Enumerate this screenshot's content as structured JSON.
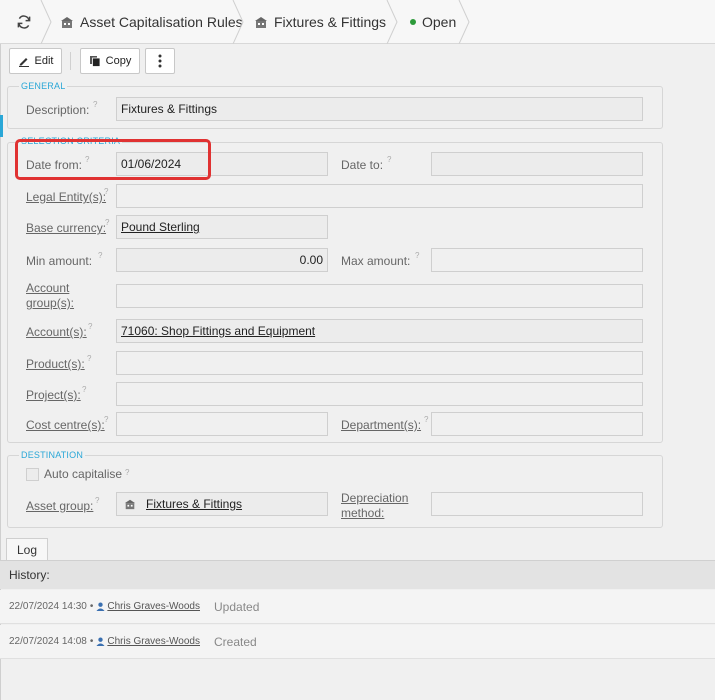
{
  "breadcrumb": {
    "items": [
      "Asset Capitalisation Rules",
      "Fixtures & Fittings"
    ],
    "status": "Open"
  },
  "toolbar": {
    "edit_label": "Edit",
    "copy_label": "Copy"
  },
  "general": {
    "legend": "GENERAL",
    "description_label": "Description:",
    "description_value": "Fixtures & Fittings"
  },
  "criteria": {
    "legend": "SELECTION CRITERIA",
    "date_from_label": "Date from:",
    "date_from_value": "01/06/2024",
    "date_to_label": "Date to:",
    "date_to_value": "",
    "legal_entity_label": "Legal Entity(s):",
    "legal_entity_value": "",
    "base_currency_label": "Base currency:",
    "base_currency_value": "Pound Sterling",
    "min_amount_label": "Min amount:",
    "min_amount_value": "0.00",
    "max_amount_label": "Max amount:",
    "max_amount_value": "",
    "account_group_label_1": "Account",
    "account_group_label_2": "group(s):",
    "account_group_value": "",
    "accounts_label": "Account(s):",
    "accounts_value": "71060: Shop Fittings and Equipment",
    "products_label": "Product(s):",
    "products_value": "",
    "projects_label": "Project(s):",
    "projects_value": "",
    "cost_centre_label": "Cost centre(s):",
    "cost_centre_value": "",
    "department_label": "Department(s):",
    "department_value": ""
  },
  "destination": {
    "legend": "DESTINATION",
    "auto_capitalise_label": "Auto capitalise",
    "auto_capitalise_checked": false,
    "asset_group_label": "Asset group:",
    "asset_group_value": "Fixtures & Fittings",
    "depreciation_label_1": "Depreciation",
    "depreciation_label_2": "method:",
    "depreciation_value": ""
  },
  "log": {
    "tab_label": "Log",
    "history_label": "History:",
    "entries": [
      {
        "timestamp": "22/07/2024 14:30",
        "user": "Chris Graves-Woods",
        "action": "Updated"
      },
      {
        "timestamp": "22/07/2024 14:08",
        "user": "Chris Graves-Woods",
        "action": "Created"
      }
    ]
  },
  "colors": {
    "accent": "#2aa7d7",
    "highlight": "#e03232",
    "status_open": "#2c9a3a"
  },
  "icons": {
    "refresh": "refresh-icon",
    "breadcrumb": "building-icon",
    "edit": "pencil-icon",
    "copy": "copy-icon",
    "more": "kebab-menu-icon",
    "user": "user-icon",
    "question": "help-icon"
  }
}
